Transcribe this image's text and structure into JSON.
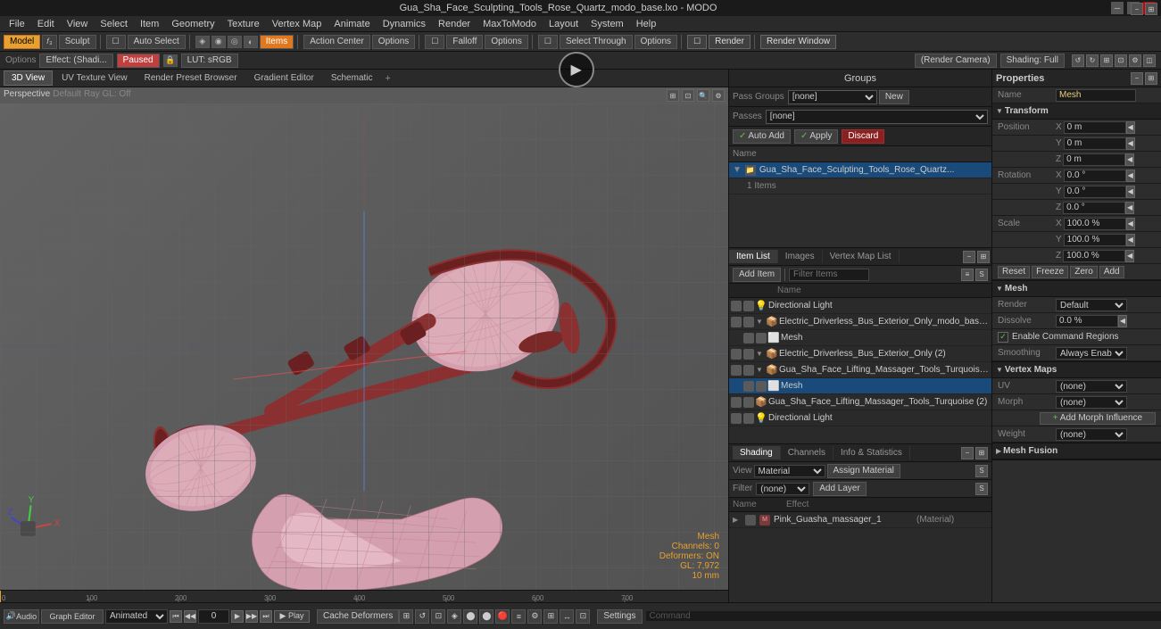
{
  "window": {
    "title": "Gua_Sha_Face_Sculpting_Tools_Rose_Quartz_modo_base.lxo - MODO"
  },
  "menu": {
    "items": [
      "File",
      "Edit",
      "View",
      "Select",
      "Item",
      "Geometry",
      "Texture",
      "Vertex Map",
      "Animate",
      "Dynamics",
      "Render",
      "MaxToModo",
      "Layout",
      "System",
      "Help"
    ]
  },
  "toolbar": {
    "mode_label": "Model",
    "sculpt_label": "Sculpt",
    "auto_select": "Auto Select",
    "items_label": "Items",
    "action_center": "Action Center",
    "options1": "Options",
    "falloff": "Falloff",
    "options2": "Options",
    "select_through": "Select Through",
    "options3": "Options",
    "render_label": "Render",
    "render_window": "Render Window"
  },
  "viewport_header": {
    "left": [
      "3D View",
      "UV Texture View",
      "Render Preset Browser",
      "Gradient Editor",
      "Schematic"
    ],
    "add_tab": "+",
    "view_mode": "Perspective",
    "default_label": "Default",
    "ray_gl": "Ray GL: Off"
  },
  "groups": {
    "header": "Groups",
    "pass_groups_label": "Pass Groups",
    "pass_groups_value": "[none]",
    "passes_label": "Passes",
    "passes_value": "[none]",
    "new_btn": "New",
    "auto_add": "Auto Add",
    "apply": "Apply",
    "discard": "Discard",
    "col_name": "Name",
    "items": [
      {
        "name": "Gua_Sha_Face_Sculpting_Tools_Rose_Quartz...",
        "selected": true,
        "sub": "1 Items"
      }
    ]
  },
  "item_list": {
    "tabs": [
      "Item List",
      "Images",
      "Vertex Map List"
    ],
    "add_item": "Add Item",
    "filter": "Filter Items",
    "col_name": "Name",
    "items": [
      {
        "name": "Directional Light",
        "type": "light",
        "indent": 0,
        "expanded": false
      },
      {
        "name": "Electric_Driverless_Bus_Exterior_Only_modo_base.lxo*",
        "type": "group",
        "indent": 0,
        "expanded": true
      },
      {
        "name": "Mesh",
        "type": "mesh",
        "indent": 1,
        "expanded": false
      },
      {
        "name": "Electric_Driverless_Bus_Exterior_Only (2)",
        "type": "group",
        "indent": 0,
        "expanded": true
      },
      {
        "name": "Gua_Sha_Face_Lifting_Massager_Tools_Turquoise_modo...",
        "type": "group",
        "indent": 0,
        "expanded": true
      },
      {
        "name": "Mesh",
        "type": "mesh",
        "indent": 1,
        "expanded": false
      },
      {
        "name": "Gua_Sha_Face_Lifting_Massager_Tools_Turquoise (2)",
        "type": "group",
        "indent": 0,
        "expanded": false
      },
      {
        "name": "Directional Light",
        "type": "light",
        "indent": 0,
        "expanded": false
      }
    ]
  },
  "shading": {
    "tabs": [
      "Shading",
      "Channels",
      "Info & Statistics"
    ],
    "view_label": "View",
    "view_value": "Material",
    "assign_material": "Assign Material",
    "filter_label": "Filter",
    "filter_value": "(none)",
    "add_layer": "Add Layer",
    "col_name": "Name",
    "col_effect": "Effect",
    "items": [
      {
        "name": "Pink_Guasha_massager_1",
        "type": "Material",
        "expanded": true
      }
    ]
  },
  "properties": {
    "header": "Properties",
    "name_label": "Name",
    "name_value": "Mesh",
    "transform": {
      "header": "Transform",
      "position": {
        "label": "Position",
        "x": "0 m",
        "y": "0 m",
        "z": "0 m"
      },
      "rotation": {
        "label": "Rotation",
        "x": "0.0 °",
        "y": "0.0 °",
        "z": "0.0 °"
      },
      "scale": {
        "label": "Scale",
        "x": "100.0 %",
        "y": "100.0 %",
        "z": "100.0 %"
      },
      "reset_btn": "Reset",
      "freeze_btn": "Freeze",
      "zero_btn": "Zero",
      "add_btn": "Add"
    },
    "mesh": {
      "header": "Mesh",
      "render_label": "Render",
      "render_value": "Default",
      "dissolve_label": "Dissolve",
      "dissolve_value": "0.0 %",
      "enable_cmd_label": "Enable Command Regions",
      "smoothing_label": "Smoothing",
      "smoothing_value": "Always Enabled"
    },
    "vertex_maps": {
      "header": "Vertex Maps",
      "uv_label": "UV",
      "uv_value": "(none)",
      "morph_label": "Morph",
      "morph_value": "(none)",
      "add_morph_btn": "Add Morph Influence",
      "weight_label": "Weight",
      "weight_value": "(none)"
    },
    "mesh_fusion": {
      "header": "Mesh Fusion"
    }
  },
  "viewport_info": {
    "mesh_label": "Mesh",
    "channels": "Channels: 0",
    "deformers": "Deformers: ON",
    "gl": "GL: 7,972",
    "size": "10 mm"
  },
  "timeline": {
    "current_frame": "0",
    "ticks": [
      "0",
      "100",
      "200",
      "300",
      "400",
      "500",
      "600",
      "700"
    ],
    "audio_btn": "Audio",
    "graph_editor": "Graph Editor",
    "animated_label": "Animated",
    "play_btn": "▶ Play",
    "cache_deformers": "Cache Deformers",
    "settings_btn": "Settings"
  },
  "top_bar": {
    "effect_label": "Effect: (Shadi...",
    "paused_label": "Paused",
    "lut_label": "LUT: sRGB",
    "render_camera": "(Render Camera)",
    "shading_label": "Shading: Full"
  },
  "colors": {
    "accent_orange": "#e8a030",
    "selected_blue": "#1a4a7a",
    "active_green": "#6cbe45",
    "danger_red": "#8a2020",
    "mesh_color": "#d4a0a8"
  }
}
